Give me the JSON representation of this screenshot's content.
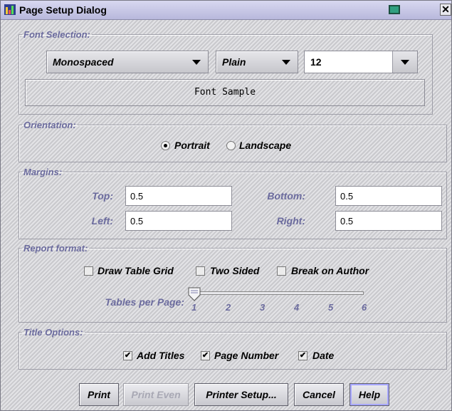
{
  "window": {
    "title": "Page Setup Dialog",
    "icons": {
      "app": "chart-app-icon",
      "maximize": "maximize-icon",
      "close": "close-icon"
    },
    "close_glyph": "✕"
  },
  "font_selection": {
    "legend": "Font Selection:",
    "family": "Monospaced",
    "style": "Plain",
    "size": "12",
    "sample": "Font Sample"
  },
  "orientation": {
    "legend": "Orientation:",
    "portrait": "Portrait",
    "landscape": "Landscape",
    "selected": "Portrait"
  },
  "margins": {
    "legend": "Margins:",
    "top_label": "Top:",
    "top": "0.5",
    "bottom_label": "Bottom:",
    "bottom": "0.5",
    "left_label": "Left:",
    "left": "0.5",
    "right_label": "Right:",
    "right": "0.5"
  },
  "report_format": {
    "legend": "Report format:",
    "draw_table_grid": "Draw Table Grid",
    "two_sided": "Two Sided",
    "break_on_author": "Break on Author",
    "draw_table_grid_checked": false,
    "two_sided_checked": false,
    "break_on_author_checked": false,
    "tables_per_page_label": "Tables per Page:",
    "tables_per_page_value": 1,
    "ticks": [
      "1",
      "2",
      "3",
      "4",
      "5",
      "6"
    ]
  },
  "title_options": {
    "legend": "Title Options:",
    "add_titles": "Add Titles",
    "page_number": "Page Number",
    "date": "Date",
    "checked_mark": "✔"
  },
  "buttons": {
    "print": "Print",
    "print_even": "Print Even",
    "printer_setup": "Printer Setup...",
    "cancel": "Cancel",
    "help": "Help"
  },
  "colors": {
    "accent_text": "#6b6b9e",
    "focus_ring": "#a8a8ff"
  }
}
